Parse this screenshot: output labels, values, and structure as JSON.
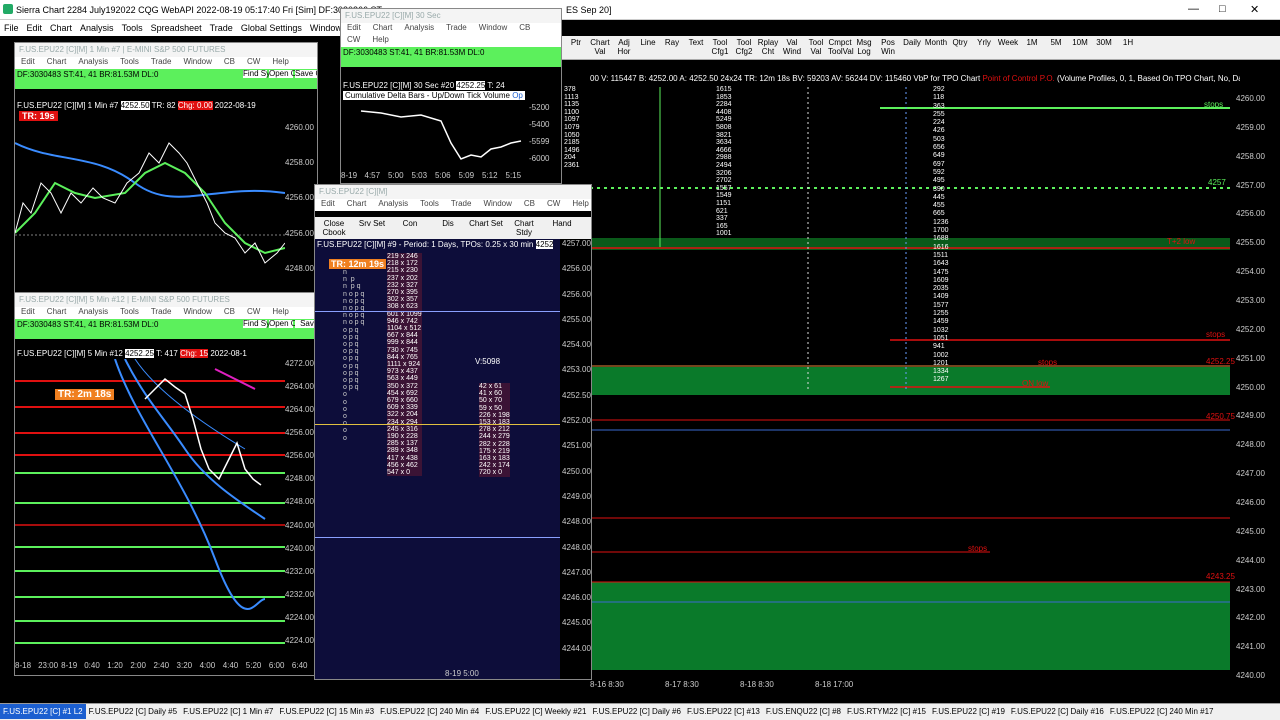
{
  "app": {
    "title": "Sierra Chart 2284 July192022  CQG WebAPI 2022-08-19  05:17:40 Fri [Sim]  DF:3030366  ST",
    "title_tail": "ES Sep 20]",
    "menu": [
      "File",
      "Edit",
      "Chart",
      "Analysis",
      "Tools",
      "Spreadsheet",
      "Trade",
      "Global Settings",
      "Window"
    ]
  },
  "toolbar": {
    "buttons": [
      "Ptr",
      "Chart Val",
      "Adj Hor",
      "Line",
      "Ray",
      "Text",
      "Tool Cfg1",
      "Tool Cfg2",
      "Rplay Cht",
      "Val Wind",
      "Tool Val",
      "Cmpct ToolVal",
      "Msg Log",
      "Pos Win",
      "Daily",
      "Month",
      "Qtry",
      "Yrly",
      "Week",
      "1M",
      "5M",
      "10M",
      "30M",
      "1H"
    ]
  },
  "w1min": {
    "title": "F.US.EPU22 [C][M]  1 Min  #7 | E-MINI S&P 500 FUTURES",
    "menu": [
      "Edit",
      "Chart",
      "Analysis",
      "Tools",
      "Trade",
      "Window",
      "CB",
      "CW",
      "Help"
    ],
    "info": "DF:3030483  ST:41, 41  BR:81.53M  DL:0",
    "btn_find": "Find Symb",
    "btn_open": "Open Cbook",
    "btn_save": "Save Cbook",
    "header": "F.US.EPU22 [C][M]  1 Min  #7",
    "h_price": "4252.50",
    "h_tr": "TR: 82",
    "h_chg": "Chg: 0.00",
    "h_date": "2022-08-19",
    "tr": "TR: 19s",
    "prices": [
      "4260.00",
      "4258.00",
      "4256.00",
      "4256.00",
      "4248.00"
    ]
  },
  "w30sec": {
    "title": "F.US.EPU22 [C][M]  30 Sec",
    "menu": [
      "Edit",
      "Chart",
      "Analysis",
      "Trade",
      "Window",
      "CB"
    ],
    "menu2": [
      "CW",
      "Help"
    ],
    "info": "DF:3030483  ST:41, 41  BR:81.53M  DL:0",
    "header": "F.US.EPU22 [C][M]  30 Sec  #20",
    "h_price": "4252.25",
    "h_tr": "T: 24",
    "study": "Cumulative Delta Bars - Up/Down Tick Volume",
    "study_tag": "Op",
    "prices": [
      "-5200",
      "-5400",
      "-5599",
      "-6000"
    ],
    "times": [
      "8-19",
      "4:57",
      "5:00",
      "5:03",
      "5:06",
      "5:09",
      "5:12",
      "5:15"
    ]
  },
  "w5min": {
    "title": "F.US.EPU22 [C][M]  5 Min  #12 | E-MINI S&P 500 FUTURES",
    "menu": [
      "Edit",
      "Chart",
      "Analysis",
      "Tools",
      "Trade",
      "Window",
      "CB",
      "CW",
      "Help"
    ],
    "info": "DF:3030483  ST:41, 41  BR:81.53M  DL:0",
    "btn_find": "Find Symb",
    "btn_open": "Open Cbook",
    "btn_save": "Sav",
    "header": "F.US.EPU22 [C][M]  5 Min  #12",
    "h_price": "4252.25",
    "h_tr": "T: 417",
    "h_chg": "Chg: 15",
    "h_date": "2022-08-1",
    "tr": "TR: 2m 18s",
    "prices": [
      "4272.00",
      "4264.00",
      "4264.00",
      "4256.00",
      "4256.00",
      "4248.00",
      "4248.00",
      "4240.00",
      "4240.00",
      "4232.00",
      "4232.00",
      "4224.00",
      "4224.00"
    ],
    "times": [
      "8-18",
      "23:00",
      "8-19",
      "0:40",
      "1:20",
      "2:00",
      "2:40",
      "3:20",
      "4:00",
      "4:40",
      "5:20",
      "6:00",
      "6:40"
    ]
  },
  "wtpo": {
    "title": "F.US.EPU22 [C][M]",
    "menu": [
      "Edit",
      "Chart",
      "Analysis",
      "Tools",
      "Trade",
      "Window",
      "CB",
      "CW",
      "Help"
    ],
    "buttons": [
      "Close Cbook",
      "Srv Set",
      "Con",
      "Dis",
      "Chart Set",
      "Chart Stdy",
      "Hand"
    ],
    "header": "F.US.EPU22 [C][M]  #9 - Period: 1 Days, TPOs: 0.25 x 30 min",
    "h_price": "4252",
    "tr": "TR: 12m 19s",
    "vol": "V:5098",
    "rows_left": [
      "219 x 246",
      "218 x 172",
      "215 x 230",
      "237 x 202",
      "232 x 327",
      "270 x 395",
      "302 x 357",
      "308 x 623",
      "601 x 1099",
      "946 x 742",
      "1104 x 512",
      "667 x 844",
      "999 x 844",
      "730 x 745",
      "844 x 765",
      "1111 x 924",
      "973 x 437",
      "563 x 449",
      "350 x 372",
      "454 x 692",
      "679 x 660",
      "609 x 339",
      "322 x 204",
      "234 x 294",
      "245 x 316",
      "190 x 228",
      "285 x 137",
      "289 x 348",
      "417 x 438",
      "456 x 462",
      "547 x 0"
    ],
    "rows_right": [
      "42 x 61",
      "41 x 60",
      "50 x 70",
      "59 x 50",
      "226 x 198",
      "153 x 183",
      "278 x 212",
      "244 x 279",
      "282 x 228",
      "175 x 219",
      "163 x 183",
      "242 x 174",
      "720 x 0"
    ],
    "prices": [
      "4257.00",
      "4256.00",
      "4256.00",
      "4255.00",
      "4254.00",
      "4253.00",
      "4252.50",
      "4252.00",
      "4251.00",
      "4250.00",
      "4249.00",
      "4248.00",
      "4248.00",
      "4247.00",
      "4246.00",
      "4245.00",
      "4244.00"
    ],
    "date": "8-19  5:00"
  },
  "main": {
    "header": "00  V: 115447  B: 4252.00  A: 4252.50  24x24  TR: 12m 18s  BV: 59203  AV: 56244  DV: 115460  VbP for TPO Chart",
    "poc": "Point of Control P.O.",
    "vp_label": "(Volume Profiles, 0, 1, Based On TPO Chart, No, Days, 1, 50, 10",
    "prices": [
      "4260.00",
      "4259.00",
      "4258.00",
      "4257.00",
      "4256.00",
      "4255.00",
      "4254.00",
      "4253.00",
      "4252.00",
      "4251.00",
      "4250.00",
      "4249.00",
      "4248.00",
      "4247.00",
      "4246.00",
      "4245.00",
      "4244.00",
      "4243.00",
      "4242.00",
      "4241.00",
      "4240.00"
    ],
    "annots": {
      "stops1": "stops",
      "lvl4257": "4257",
      "t2": "T+2 low",
      "stops2": "stops",
      "stops3": "stops",
      "on_low": "ON low",
      "stops4": "stops",
      "p4252": "4252.25",
      "p4243": "4243.25",
      "p4250": "4250.75"
    },
    "vol_col": [
      "292",
      "118",
      "363",
      "255",
      "224",
      "426",
      "503",
      "656",
      "649",
      "697",
      "592",
      "495",
      "390",
      "445",
      "455",
      "665",
      "1236",
      "1700",
      "1688",
      "1616",
      "1511",
      "1643",
      "1475",
      "1609",
      "2035",
      "1409",
      "1577",
      "1255",
      "1459",
      "1032",
      "1051",
      "941",
      "1002",
      "1201",
      "1334",
      "1267"
    ],
    "col_a": [
      "378",
      "1113",
      "1135",
      "1100",
      "1097",
      "1079",
      "1050",
      "2185",
      "1496",
      "204",
      "2361"
    ],
    "col_b": [
      "1615",
      "1853",
      "2284",
      "4408",
      "5249",
      "5808",
      "3821",
      "3634",
      "4666",
      "2988",
      "2494",
      "3206",
      "2702",
      "1557",
      "1549",
      "1151",
      "621",
      "337",
      "165",
      "1001"
    ],
    "dates": [
      "8-16  8:30",
      "8-17  8:30",
      "8-18  8:30",
      "8-18  17:00"
    ]
  },
  "tabs": [
    "F.US.EPU22 [C]  #1 L2",
    "F.US.EPU22 [C]  Daily  #5",
    "F.US.EPU22 [C]  1 Min  #7",
    "F.US.EPU22 [C]  15 Min  #3",
    "F.US.EPU22 [C]  240 Min  #4",
    "F.US.EPU22 [C]  Weekly  #21",
    "F.US.EPU22 [C]  Daily  #6",
    "F.US.EPU22 [C]  #13",
    "F.US.ENQU22 [C]  #8",
    "F.US.RTYM22 [C]  #15",
    "F.US.EPU22 [C]  #19",
    "F.US.EPU22 [C]  Daily  #16",
    "F.US.EPU22 [C]  240 Min  #17"
  ],
  "colors": {
    "green": "#5cf05c",
    "blue": "#1c5fd0",
    "red": "#e01010",
    "navy": "#0d0d3a"
  }
}
